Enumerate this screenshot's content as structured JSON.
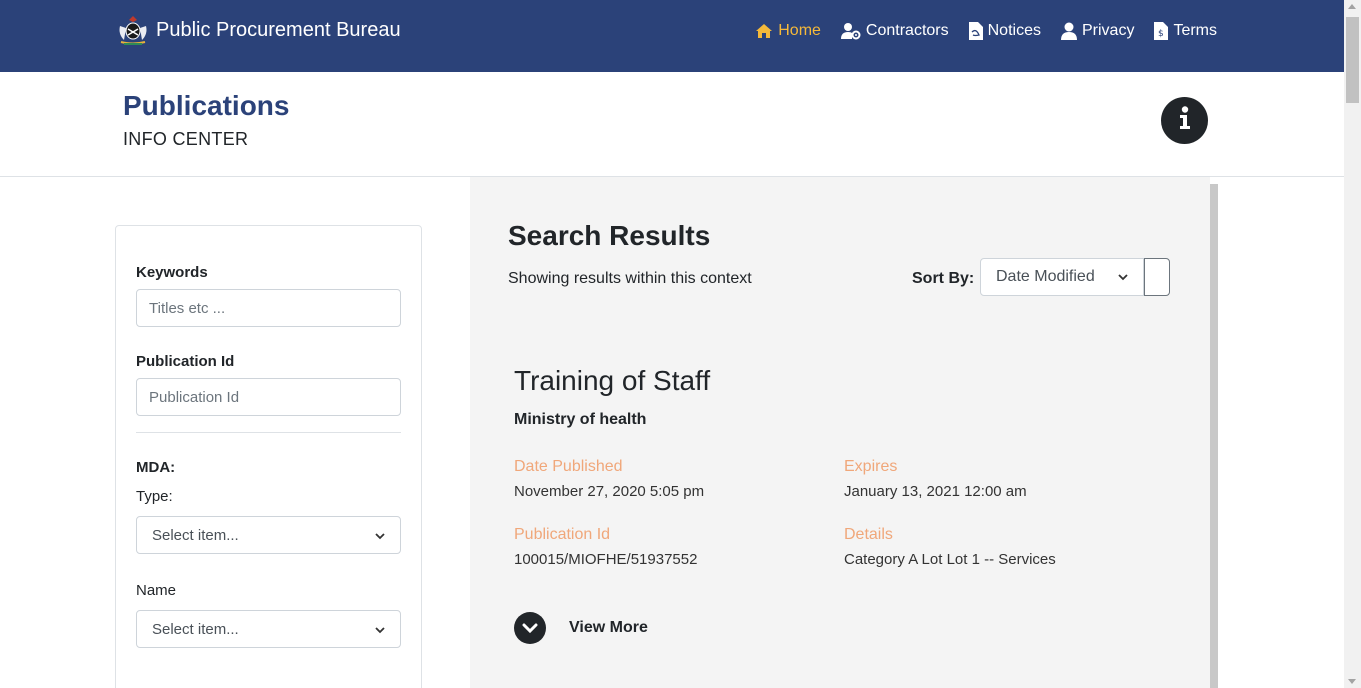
{
  "navbar": {
    "brand": "Public Procurement Bureau",
    "items": [
      {
        "label": "Home",
        "icon": "home-icon",
        "active": true
      },
      {
        "label": "Contractors",
        "icon": "users-cog-icon",
        "active": false
      },
      {
        "label": "Notices",
        "icon": "file-pdf-icon",
        "active": false
      },
      {
        "label": "Privacy",
        "icon": "user-icon",
        "active": false
      },
      {
        "label": "Terms",
        "icon": "file-invoice-icon",
        "active": false
      }
    ],
    "colors": {
      "background": "#2b4279",
      "active": "#f5b93a"
    }
  },
  "header": {
    "title": "Publications",
    "subtitle": "INFO CENTER",
    "info_icon": "info-icon"
  },
  "filters": {
    "keywords_label": "Keywords",
    "keywords_placeholder": "Titles etc ...",
    "publication_id_label": "Publication Id",
    "publication_id_placeholder": "Publication Id",
    "mda_label": "MDA:",
    "type_label": "Type:",
    "type_value": "Select item...",
    "name_label": "Name",
    "name_value": "Select item..."
  },
  "results": {
    "title": "Search Results",
    "context": "Showing results within this context",
    "sort_label": "Sort By:",
    "sort_value": "Date Modified",
    "item": {
      "title": "Training of Staff",
      "mda": "Ministry of health",
      "date_published_label": "Date Published",
      "date_published": "November 27, 2020 5:05 pm",
      "expires_label": "Expires",
      "expires": "January 13, 2021 12:00 am",
      "publication_id_label": "Publication Id",
      "publication_id": "100015/MIOFHE/51937552",
      "details_label": "Details",
      "details": "Category A Lot Lot 1 -- Services",
      "view_more": "View More"
    },
    "label_color": "#f0a77a"
  }
}
